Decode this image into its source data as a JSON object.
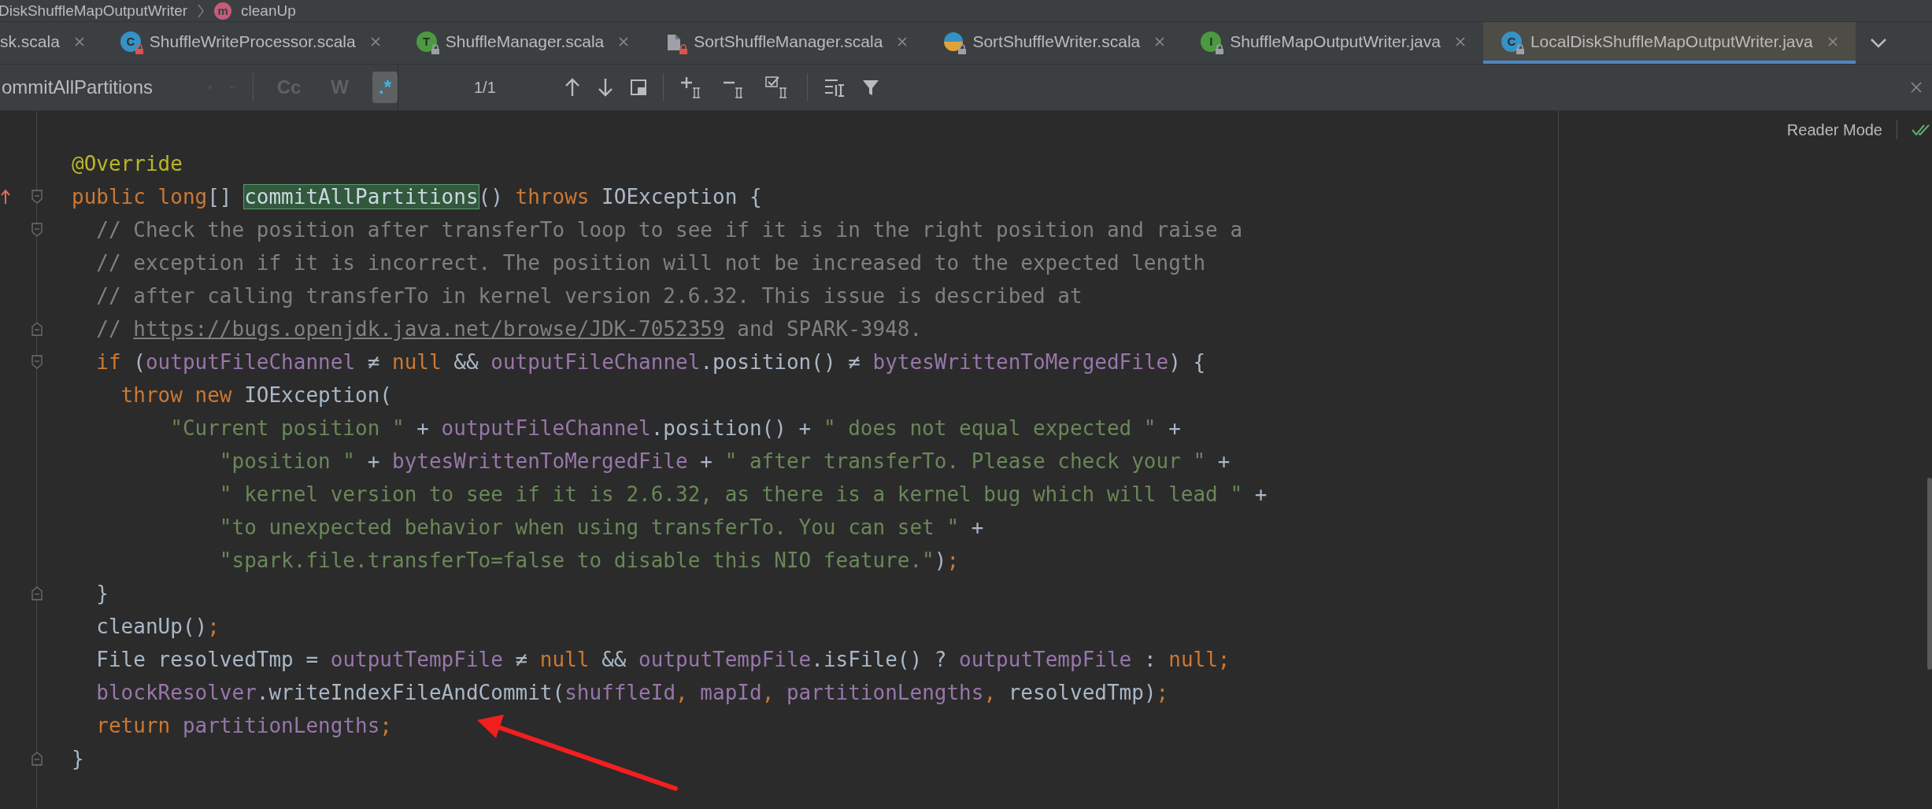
{
  "breadcrumbs": [
    {
      "label": "DiskShuffleMapOutputWriter"
    },
    {
      "label": "cleanUp",
      "icon_letter": "m"
    }
  ],
  "tabs": [
    {
      "label": "sk.scala",
      "selected": false
    },
    {
      "label": "ShuffleWriteProcessor.scala",
      "icon": {
        "kind": "class",
        "letter": "C",
        "lock": {
          "color": "#d9534f"
        }
      },
      "selected": false
    },
    {
      "label": "ShuffleManager.scala",
      "icon": {
        "kind": "trait",
        "letter": "T",
        "lock": {
          "color": "#9da0a8"
        }
      },
      "selected": false
    },
    {
      "label": "SortShuffleManager.scala",
      "icon": {
        "kind": "file",
        "lock": {
          "color": "#d9534f"
        }
      },
      "selected": false
    },
    {
      "label": "SortShuffleWriter.scala",
      "icon": {
        "kind": "companion",
        "lock": {
          "color": "#9da0a8"
        }
      },
      "selected": false
    },
    {
      "label": "ShuffleMapOutputWriter.java",
      "icon": {
        "kind": "interface",
        "letter": "I",
        "lock": {
          "color": "#9da0a8"
        }
      },
      "selected": false
    },
    {
      "label": "LocalDiskShuffleMapOutputWriter.java",
      "icon": {
        "kind": "class",
        "letter": "C",
        "lock": {
          "color": "#9da0a8"
        }
      },
      "selected": true
    }
  ],
  "find_bar": {
    "value": "ommitAllPartitions",
    "options": [
      {
        "label": "Cc",
        "selected": false
      },
      {
        "label": "W",
        "selected": false
      },
      {
        "label": ".*",
        "selected": true
      }
    ],
    "match_count": "1/1"
  },
  "reader_mode": "Reader Mode",
  "code": [
    {
      "tokens": [
        {
          "kind": "annotation",
          "text": "@Override"
        }
      ]
    },
    {
      "override": true,
      "fold_marker": {
        "kind": "start"
      },
      "tokens": [
        {
          "kind": "keyword",
          "text": "public long"
        },
        {
          "kind": "plain",
          "text": "[] "
        },
        {
          "kind": "match",
          "text": "commitAllPartitions"
        },
        {
          "kind": "plain",
          "text": "() "
        },
        {
          "kind": "keyword",
          "text": "throws"
        },
        {
          "kind": "plain",
          "text": " IOException {"
        }
      ]
    },
    {
      "fold_marker": {
        "kind": "start"
      },
      "tokens": [
        {
          "kind": "comment",
          "text": "  // Check the position after transferTo loop to see if it is in the right position and raise a"
        }
      ]
    },
    {
      "tokens": [
        {
          "kind": "comment",
          "text": "  // exception if it is incorrect. The position will not be increased to the expected length"
        }
      ]
    },
    {
      "tokens": [
        {
          "kind": "comment",
          "text": "  // after calling transferTo in kernel version 2.6.32. This issue is described at"
        }
      ]
    },
    {
      "fold_marker": {
        "kind": "end"
      },
      "tokens": [
        {
          "kind": "comment",
          "text": "  // "
        },
        {
          "kind": "link",
          "text": "https://bugs.openjdk.java.net/browse/JDK-7052359"
        },
        {
          "kind": "comment",
          "text": " and SPARK-3948."
        }
      ]
    },
    {
      "fold_marker": {
        "kind": "start"
      },
      "tokens": [
        {
          "kind": "keyword",
          "text": "  if"
        },
        {
          "kind": "plain",
          "text": " ("
        },
        {
          "kind": "field",
          "text": "outputFileChannel"
        },
        {
          "kind": "plain",
          "text": " ≠ "
        },
        {
          "kind": "keyword",
          "text": "null"
        },
        {
          "kind": "plain",
          "text": " && "
        },
        {
          "kind": "field",
          "text": "outputFileChannel"
        },
        {
          "kind": "plain",
          "text": ".position() ≠ "
        },
        {
          "kind": "field",
          "text": "bytesWrittenToMergedFile"
        },
        {
          "kind": "plain",
          "text": ") {"
        }
      ]
    },
    {
      "tokens": [
        {
          "kind": "keyword",
          "text": "    throw new"
        },
        {
          "kind": "plain",
          "text": " IOException("
        }
      ]
    },
    {
      "tokens": [
        {
          "kind": "string",
          "text": "        \"Current position \""
        },
        {
          "kind": "plain",
          "text": " + "
        },
        {
          "kind": "field",
          "text": "outputFileChannel"
        },
        {
          "kind": "plain",
          "text": ".position() + "
        },
        {
          "kind": "string",
          "text": "\" does not equal expected \""
        },
        {
          "kind": "plain",
          "text": " +"
        }
      ]
    },
    {
      "tokens": [
        {
          "kind": "string",
          "text": "            \"position \""
        },
        {
          "kind": "plain",
          "text": " + "
        },
        {
          "kind": "field",
          "text": "bytesWrittenToMergedFile"
        },
        {
          "kind": "plain",
          "text": " + "
        },
        {
          "kind": "string",
          "text": "\" after transferTo. Please check your \""
        },
        {
          "kind": "plain",
          "text": " +"
        }
      ]
    },
    {
      "tokens": [
        {
          "kind": "string",
          "text": "            \" kernel version to see if it is 2.6.32, as there is a kernel bug which will lead \""
        },
        {
          "kind": "plain",
          "text": " +"
        }
      ]
    },
    {
      "tokens": [
        {
          "kind": "string",
          "text": "            \"to unexpected behavior when using transferTo. You can set \""
        },
        {
          "kind": "plain",
          "text": " +"
        }
      ]
    },
    {
      "tokens": [
        {
          "kind": "string",
          "text": "            \"spark.file.transferTo=false to disable this NIO feature.\""
        },
        {
          "kind": "plain",
          "text": ")"
        },
        {
          "kind": "punct",
          "text": ";"
        }
      ]
    },
    {
      "fold_marker": {
        "kind": "end"
      },
      "tokens": [
        {
          "kind": "plain",
          "text": "  }"
        }
      ]
    },
    {
      "tokens": [
        {
          "kind": "plain",
          "text": "  cleanUp()"
        },
        {
          "kind": "punct",
          "text": ";"
        }
      ]
    },
    {
      "tokens": [
        {
          "kind": "plain",
          "text": "  File resolvedTmp = "
        },
        {
          "kind": "field",
          "text": "outputTempFile"
        },
        {
          "kind": "plain",
          "text": " ≠ "
        },
        {
          "kind": "keyword",
          "text": "null"
        },
        {
          "kind": "plain",
          "text": " && "
        },
        {
          "kind": "field",
          "text": "outputTempFile"
        },
        {
          "kind": "plain",
          "text": ".isFile() ? "
        },
        {
          "kind": "field",
          "text": "outputTempFile"
        },
        {
          "kind": "plain",
          "text": " : "
        },
        {
          "kind": "keyword",
          "text": "null"
        },
        {
          "kind": "punct",
          "text": ";"
        }
      ]
    },
    {
      "tokens": [
        {
          "kind": "field",
          "text": "  blockResolver"
        },
        {
          "kind": "plain",
          "text": ".writeIndexFileAndCommit("
        },
        {
          "kind": "field",
          "text": "shuffleId"
        },
        {
          "kind": "punct",
          "text": ", "
        },
        {
          "kind": "field",
          "text": "mapId"
        },
        {
          "kind": "punct",
          "text": ", "
        },
        {
          "kind": "field",
          "text": "partitionLengths"
        },
        {
          "kind": "punct",
          "text": ", "
        },
        {
          "kind": "plain",
          "text": "resolvedTmp)"
        },
        {
          "kind": "punct",
          "text": ";"
        }
      ]
    },
    {
      "tokens": [
        {
          "kind": "keyword",
          "text": "  return"
        },
        {
          "kind": "field",
          "text": " partitionLengths"
        },
        {
          "kind": "punct",
          "text": ";"
        }
      ]
    },
    {
      "fold_marker": {
        "kind": "end"
      },
      "tokens": [
        {
          "kind": "plain",
          "text": "}"
        }
      ]
    }
  ]
}
